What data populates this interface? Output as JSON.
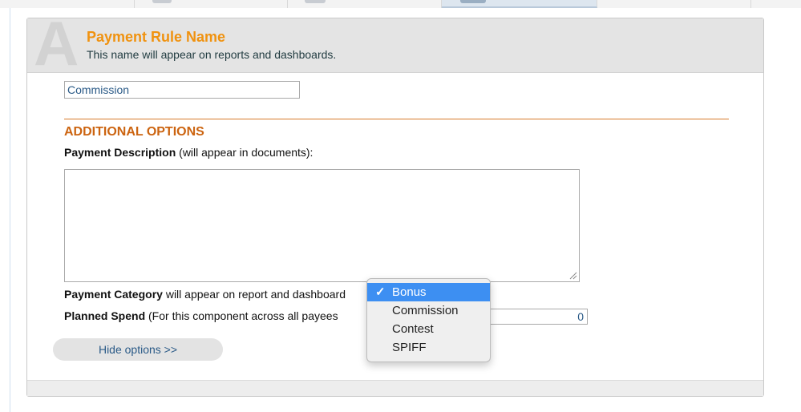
{
  "header": {
    "step_letter": "A",
    "title": "Payment Rule Name",
    "subtitle": "This name will appear on reports and dashboards."
  },
  "name_field": {
    "value": "Commission"
  },
  "additional_options": {
    "title": "ADDITIONAL OPTIONS",
    "description_label_bold": "Payment Description",
    "description_label_rest": " (will appear in documents):",
    "description_value": "",
    "category_label_bold": "Payment Category",
    "category_label_rest": " will appear on report and dashboard",
    "planned_spend_label_bold": "Planned Spend",
    "planned_spend_label_rest": " (For this component across all payees",
    "planned_spend_value": "0"
  },
  "hide_options_label": "Hide options >>",
  "category_dropdown": {
    "checkmark": "✓",
    "options": [
      {
        "label": "Bonus"
      },
      {
        "label": "Commission"
      },
      {
        "label": "Contest"
      },
      {
        "label": "SPIFF"
      }
    ],
    "selected": "Bonus"
  },
  "colors": {
    "accent_orange": "#f0920f",
    "section_orange": "#cc6410",
    "link_blue": "#2a5a87",
    "selection_blue": "#3d8ff2"
  }
}
